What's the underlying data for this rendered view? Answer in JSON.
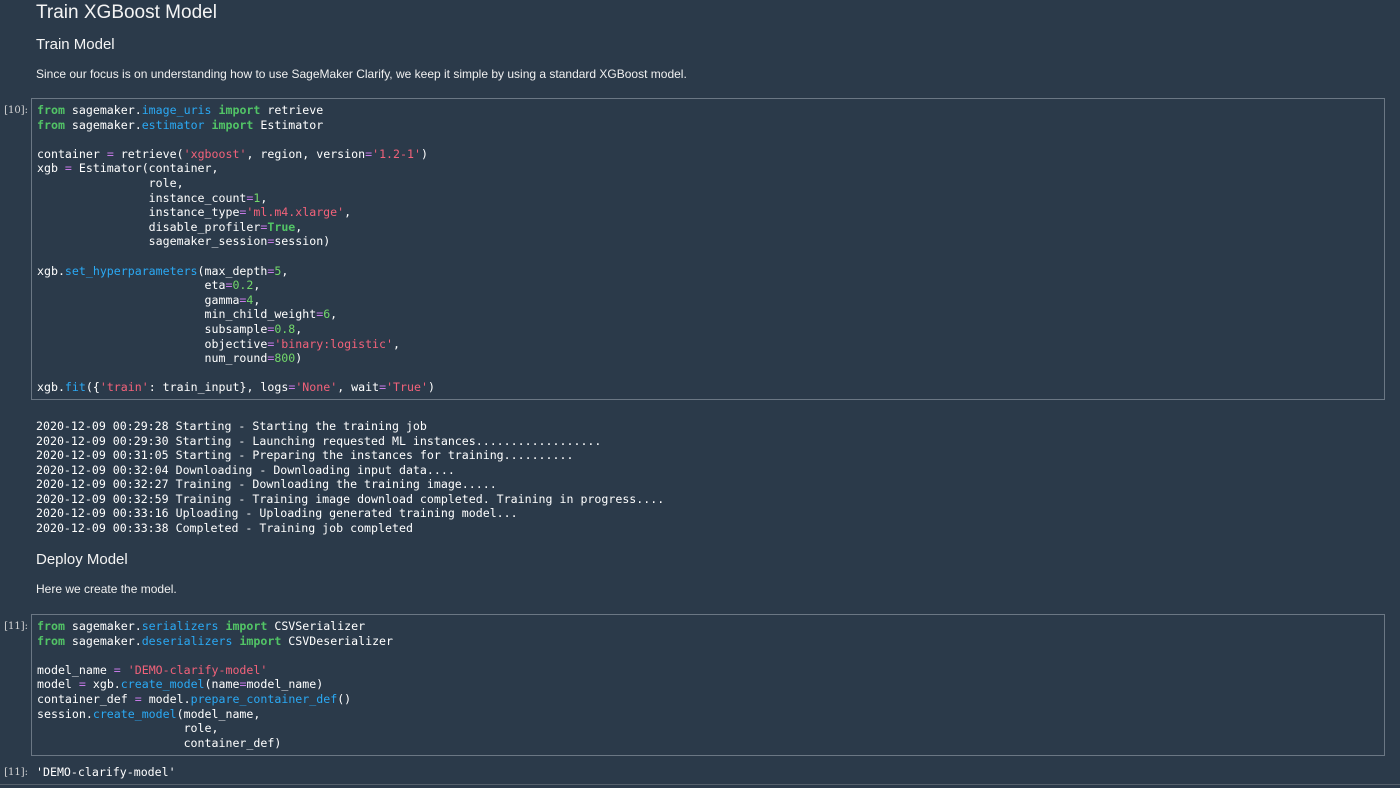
{
  "title": "Train XGBoost Model",
  "train_section": {
    "heading": "Train Model",
    "description": "Since our focus is on understanding how to use SageMaker Clarify, we keep it simple by using a standard XGBoost model."
  },
  "cell_10": {
    "prompt": "[10]:",
    "code_lines": [
      [
        [
          "kw",
          "from"
        ],
        [
          "t",
          " sagemaker."
        ],
        [
          "attr",
          "image_uris"
        ],
        [
          "t",
          " "
        ],
        [
          "kw",
          "import"
        ],
        [
          "t",
          " retrieve"
        ]
      ],
      [
        [
          "kw",
          "from"
        ],
        [
          "t",
          " sagemaker."
        ],
        [
          "attr",
          "estimator"
        ],
        [
          "t",
          " "
        ],
        [
          "kw",
          "import"
        ],
        [
          "t",
          " Estimator"
        ]
      ],
      [],
      [
        [
          "t",
          "container "
        ],
        [
          "op",
          "="
        ],
        [
          "t",
          " retrieve("
        ],
        [
          "str",
          "'xgboost'"
        ],
        [
          "t",
          ", region, version"
        ],
        [
          "op",
          "="
        ],
        [
          "str",
          "'1.2-1'"
        ],
        [
          "t",
          ")"
        ]
      ],
      [
        [
          "t",
          "xgb "
        ],
        [
          "op",
          "="
        ],
        [
          "t",
          " Estimator(container,"
        ]
      ],
      [
        [
          "t",
          "                role,"
        ]
      ],
      [
        [
          "t",
          "                instance_count"
        ],
        [
          "op",
          "="
        ],
        [
          "num",
          "1"
        ],
        [
          "t",
          ","
        ]
      ],
      [
        [
          "t",
          "                instance_type"
        ],
        [
          "op",
          "="
        ],
        [
          "str",
          "'ml.m4.xlarge'"
        ],
        [
          "t",
          ","
        ]
      ],
      [
        [
          "t",
          "                disable_profiler"
        ],
        [
          "op",
          "="
        ],
        [
          "kw",
          "True"
        ],
        [
          "t",
          ","
        ]
      ],
      [
        [
          "t",
          "                sagemaker_session"
        ],
        [
          "op",
          "="
        ],
        [
          "t",
          "session)"
        ]
      ],
      [],
      [
        [
          "t",
          "xgb."
        ],
        [
          "attr",
          "set_hyperparameters"
        ],
        [
          "t",
          "(max_depth"
        ],
        [
          "op",
          "="
        ],
        [
          "num",
          "5"
        ],
        [
          "t",
          ","
        ]
      ],
      [
        [
          "t",
          "                        eta"
        ],
        [
          "op",
          "="
        ],
        [
          "num",
          "0.2"
        ],
        [
          "t",
          ","
        ]
      ],
      [
        [
          "t",
          "                        gamma"
        ],
        [
          "op",
          "="
        ],
        [
          "num",
          "4"
        ],
        [
          "t",
          ","
        ]
      ],
      [
        [
          "t",
          "                        min_child_weight"
        ],
        [
          "op",
          "="
        ],
        [
          "num",
          "6"
        ],
        [
          "t",
          ","
        ]
      ],
      [
        [
          "t",
          "                        subsample"
        ],
        [
          "op",
          "="
        ],
        [
          "num",
          "0.8"
        ],
        [
          "t",
          ","
        ]
      ],
      [
        [
          "t",
          "                        objective"
        ],
        [
          "op",
          "="
        ],
        [
          "str",
          "'binary:logistic'"
        ],
        [
          "t",
          ","
        ]
      ],
      [
        [
          "t",
          "                        num_round"
        ],
        [
          "op",
          "="
        ],
        [
          "num",
          "800"
        ],
        [
          "t",
          ")"
        ]
      ],
      [],
      [
        [
          "t",
          "xgb."
        ],
        [
          "attr",
          "fit"
        ],
        [
          "t",
          "({"
        ],
        [
          "str",
          "'train'"
        ],
        [
          "t",
          ": train_input}, logs"
        ],
        [
          "op",
          "="
        ],
        [
          "str",
          "'None'"
        ],
        [
          "t",
          ", wait"
        ],
        [
          "op",
          "="
        ],
        [
          "str",
          "'True'"
        ],
        [
          "t",
          ")"
        ]
      ]
    ],
    "output_lines": [
      "2020-12-09 00:29:28 Starting - Starting the training job",
      "2020-12-09 00:29:30 Starting - Launching requested ML instances..................",
      "2020-12-09 00:31:05 Starting - Preparing the instances for training..........",
      "2020-12-09 00:32:04 Downloading - Downloading input data....",
      "2020-12-09 00:32:27 Training - Downloading the training image.....",
      "2020-12-09 00:32:59 Training - Training image download completed. Training in progress....",
      "2020-12-09 00:33:16 Uploading - Uploading generated training model...",
      "2020-12-09 00:33:38 Completed - Training job completed"
    ]
  },
  "deploy_section": {
    "heading": "Deploy Model",
    "description": "Here we create the model."
  },
  "cell_11": {
    "prompt": "[11]:",
    "code_lines": [
      [
        [
          "kw",
          "from"
        ],
        [
          "t",
          " sagemaker."
        ],
        [
          "attr",
          "serializers"
        ],
        [
          "t",
          " "
        ],
        [
          "kw",
          "import"
        ],
        [
          "t",
          " CSVSerializer"
        ]
      ],
      [
        [
          "kw",
          "from"
        ],
        [
          "t",
          " sagemaker."
        ],
        [
          "attr",
          "deserializers"
        ],
        [
          "t",
          " "
        ],
        [
          "kw",
          "import"
        ],
        [
          "t",
          " CSVDeserializer"
        ]
      ],
      [],
      [
        [
          "t",
          "model_name "
        ],
        [
          "op",
          "="
        ],
        [
          "t",
          " "
        ],
        [
          "str",
          "'DEMO-clarify-model'"
        ]
      ],
      [
        [
          "t",
          "model "
        ],
        [
          "op",
          "="
        ],
        [
          "t",
          " xgb."
        ],
        [
          "attr",
          "create_model"
        ],
        [
          "t",
          "(name"
        ],
        [
          "op",
          "="
        ],
        [
          "t",
          "model_name)"
        ]
      ],
      [
        [
          "t",
          "container_def "
        ],
        [
          "op",
          "="
        ],
        [
          "t",
          " model."
        ],
        [
          "attr",
          "prepare_container_def"
        ],
        [
          "t",
          "()"
        ]
      ],
      [
        [
          "t",
          "session."
        ],
        [
          "attr",
          "create_model"
        ],
        [
          "t",
          "(model_name,"
        ]
      ],
      [
        [
          "t",
          "                     role,"
        ]
      ],
      [
        [
          "t",
          "                     container_def)"
        ]
      ]
    ],
    "output_prompt": "[11]:",
    "output_text": "'DEMO-clarify-model'"
  }
}
